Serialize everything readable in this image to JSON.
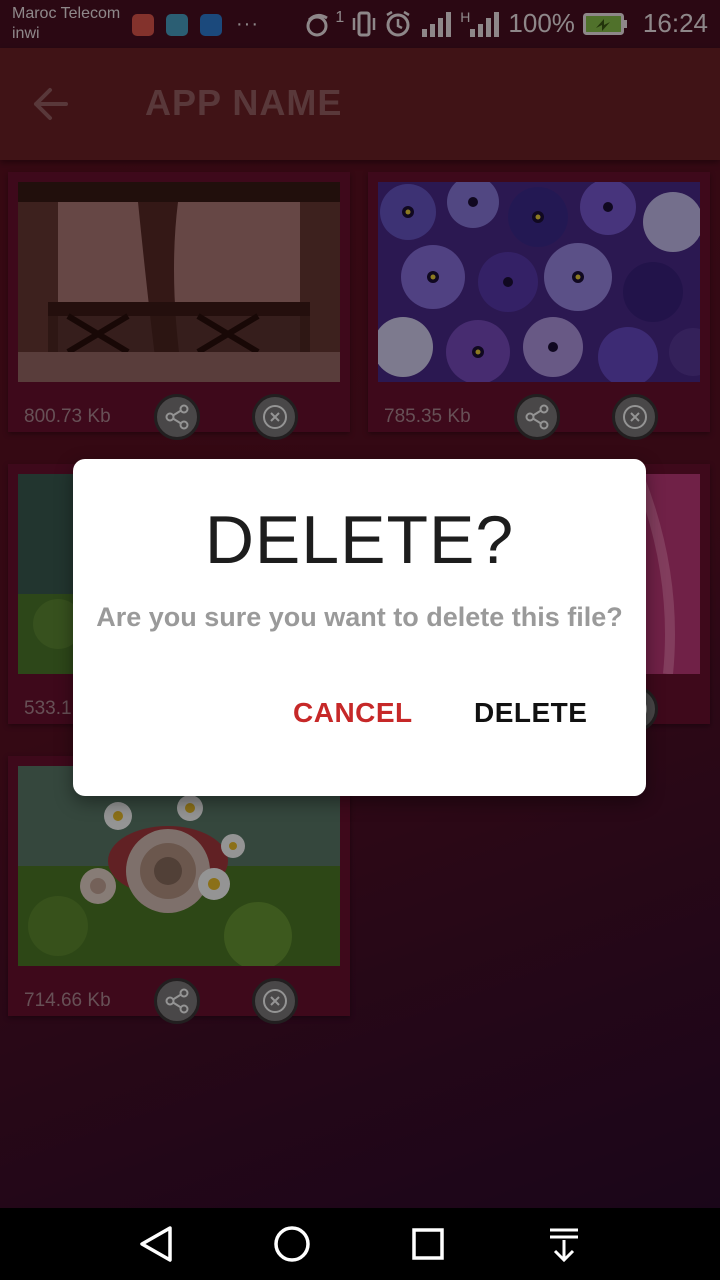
{
  "status_bar": {
    "carrier_line1": "Maroc Telecom",
    "carrier_line2": "inwi",
    "more_dots": "···",
    "sim_indicator": "1",
    "network_type": "H",
    "battery_percent": "100%",
    "time": "16:24"
  },
  "app_bar": {
    "title": "APP NAME",
    "back_icon": "arrow-left-icon"
  },
  "cards": [
    {
      "size": "800.73 Kb",
      "thumb": "dark-room-railing"
    },
    {
      "size": "785.35 Kb",
      "thumb": "purple-pansies"
    },
    {
      "size": "533.1",
      "thumb": "moss-green"
    },
    {
      "size": "",
      "thumb": "magenta-fabric"
    },
    {
      "size": "714.66 Kb",
      "thumb": "shell-daisies-moss"
    }
  ],
  "dialog": {
    "title": "DELETE?",
    "message": "Are you sure you want to delete this file?",
    "cancel_label": "CANCEL",
    "confirm_label": "DELETE"
  },
  "colors": {
    "accent_cancel": "#c62828",
    "app_bar": "#6e2127",
    "card": "#6b1130"
  },
  "nav_bar": {
    "icons": [
      "back-triangle-icon",
      "home-circle-icon",
      "recents-square-icon",
      "notifications-down-icon"
    ]
  }
}
